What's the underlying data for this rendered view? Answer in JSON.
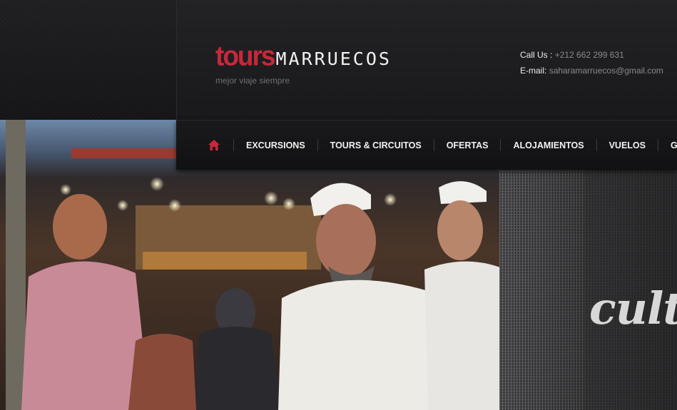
{
  "brand": {
    "logo_part1": "tours",
    "logo_part2": "MARRUECOS",
    "tagline": "mejor viaje siempre",
    "accent_color": "#c8283a"
  },
  "contact": {
    "phone_label": "Call Us :",
    "phone_value": "+212 662 299 631",
    "email_label": "E-mail:",
    "email_value": "saharamarruecos@gmail.com"
  },
  "nav": {
    "home_icon": "home-icon",
    "items": [
      {
        "label": "EXCURSIONS"
      },
      {
        "label": "TOURS & CIRCUITOS"
      },
      {
        "label": "OFERTAS"
      },
      {
        "label": "ALOJAMIENTOS"
      },
      {
        "label": "VUELOS"
      },
      {
        "label": "GALER"
      }
    ]
  },
  "hero": {
    "overlay_word": "cultu"
  }
}
